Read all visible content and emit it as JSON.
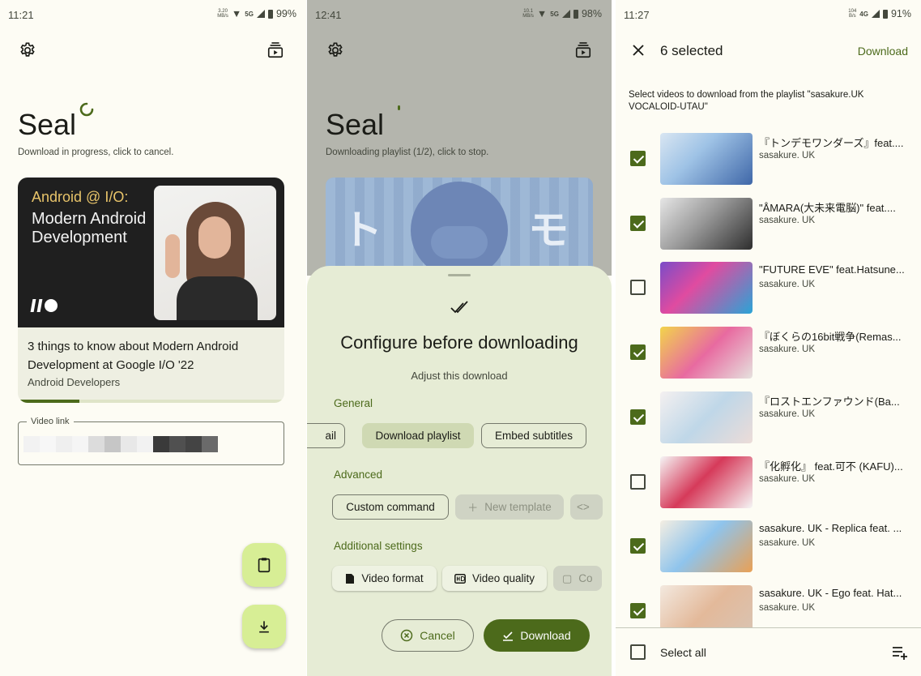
{
  "colors": {
    "primary": "#4c6a1b",
    "background": "#fdfcf4",
    "fab": "#d7ee95",
    "sheet": "#e6ecd5",
    "chip_selected": "#cfd9b3"
  },
  "screen1": {
    "status": {
      "time": "11:21",
      "net_speed_top": "3.20",
      "net_speed_bottom": "MB/s",
      "network": "5G",
      "battery": "99%"
    },
    "settings_icon": "gear-icon",
    "queue_icon": "subscriptions-icon",
    "title": "Seal",
    "subtitle": "Download in progress, click to cancel.",
    "video": {
      "thumb_line1": "Android @ I/O:",
      "thumb_line2": "Modern Android Development",
      "title": "3 things to know about Modern Android Development at Google I/O '22",
      "author": "Android Developers",
      "progress": 0.23
    },
    "input_label": "Video link",
    "fab_paste_icon": "clipboard-icon",
    "fab_download_icon": "download-icon"
  },
  "screen2": {
    "status": {
      "time": "12:41",
      "net_speed_top": "10.1",
      "net_speed_bottom": "MB/s",
      "network": "5G",
      "battery": "98%"
    },
    "title": "Seal",
    "subtitle": "Downloading playlist (1/2), click to stop.",
    "sheet": {
      "icon": "done-all-icon",
      "title": "Configure before downloading",
      "subtitle": "Adjust this download",
      "general_label": "General",
      "general_chips": [
        "ail",
        "Download playlist",
        "Embed subtitles"
      ],
      "advanced_label": "Advanced",
      "advanced_chips": [
        "Custom command",
        "New template",
        "<>"
      ],
      "additional_label": "Additional settings",
      "additional_chips": [
        "Video format",
        "Video quality",
        "Co"
      ],
      "cancel_label": "Cancel",
      "download_label": "Download"
    }
  },
  "screen3": {
    "status": {
      "time": "11:27",
      "net_speed_top": "104",
      "net_speed_bottom": "B/s",
      "network": "4G",
      "battery": "91%"
    },
    "selected_count": "6 selected",
    "action": "Download",
    "description": "Select videos to download from the playlist \"sasakure.UK VOCALOID-UTAU\"",
    "items": [
      {
        "title": "『トンデモワンダーズ』feat....",
        "author": "sasakure. UK",
        "checked": true
      },
      {
        "title": "\"ÅMARA(大未来電脳)\" feat....",
        "author": "sasakure. UK",
        "checked": true
      },
      {
        "title": "\"FUTURE EVE\" feat.Hatsune...",
        "author": "sasakure. UK",
        "checked": false
      },
      {
        "title": "『ぼくらの16bit戦争(Remas...",
        "author": "sasakure. UK",
        "checked": true
      },
      {
        "title": "『ロストエンファウンド(Ba...",
        "author": "sasakure. UK",
        "checked": true
      },
      {
        "title": "『化孵化』 feat.可不 (KAFU)...",
        "author": "sasakure. UK",
        "checked": false
      },
      {
        "title": "sasakure. UK - Replica feat. ...",
        "author": "sasakure. UK",
        "checked": true
      },
      {
        "title": "sasakure. UK - Ego  feat. Hat...",
        "author": "sasakure. UK",
        "checked": true
      }
    ],
    "select_all": "Select all",
    "playlist_add_icon": "playlist-add-icon"
  }
}
